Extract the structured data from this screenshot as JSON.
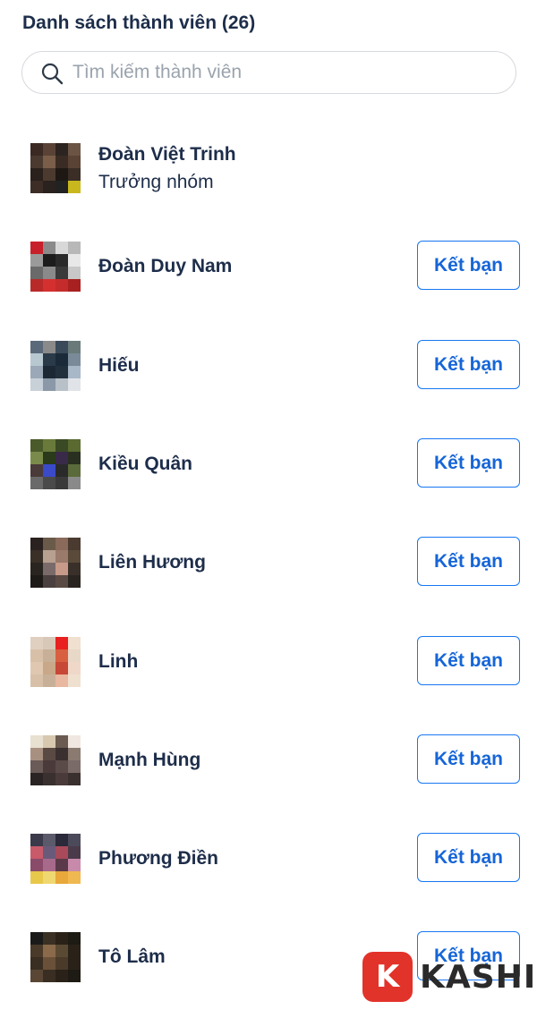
{
  "header": {
    "title": "Danh sách thành viên (26)"
  },
  "search": {
    "placeholder": "Tìm kiếm thành viên",
    "value": ""
  },
  "members": [
    {
      "name": "Đoàn Việt Trinh",
      "role": "Trưởng nhóm",
      "avatar": [
        "#3b2a24",
        "#5a4336",
        "#2c2420",
        "#6b5444",
        "#4a3a30",
        "#7a5e4a",
        "#3a2c24",
        "#5a4234",
        "#2a201c",
        "#4c3a2e",
        "#1e1814",
        "#3a2e26",
        "#3c2e26",
        "#2a221e",
        "#222",
        "#c8b81e"
      ]
    },
    {
      "name": "Đoàn Duy Nam",
      "button": "Kết bạn",
      "avatar": [
        "#c8202a",
        "#8a8a8a",
        "#d8d8d8",
        "#b8b8b8",
        "#9a9a9a",
        "#1c1c1c",
        "#2a2a2a",
        "#e8e8e8",
        "#6a6a6a",
        "#8a8a8a",
        "#3a3a3a",
        "#c8c8c8",
        "#b82a2a",
        "#d43030",
        "#c42c2c",
        "#a82020"
      ]
    },
    {
      "name": "Hiếu",
      "button": "Kết bạn",
      "avatar": [
        "#5a6a7a",
        "#8a8a8a",
        "#3a4a5a",
        "#6a7a7a",
        "#b8c8d0",
        "#2a3a48",
        "#1a2a38",
        "#7a8a98",
        "#9aa8b8",
        "#1c2834",
        "#22303e",
        "#a8b8c8",
        "#c8d0d8",
        "#8a98a8",
        "#b8c0c8",
        "#e0e4e8"
      ]
    },
    {
      "name": "Kiều Quân",
      "button": "Kết bạn",
      "avatar": [
        "#4a5a2a",
        "#6a7a3a",
        "#3a4a24",
        "#5a6a30",
        "#7a8a4a",
        "#2a3a1a",
        "#3a2a4a",
        "#2a3020",
        "#4a3a3a",
        "#3a4ac8",
        "#2a2a2a",
        "#5a6a3a",
        "#6a6a6a",
        "#4a4a4a",
        "#3a3a3a",
        "#8a8a8a"
      ]
    },
    {
      "name": "Liên Hương",
      "button": "Kết bạn",
      "avatar": [
        "#2a2220",
        "#6a5a4a",
        "#8a6a5a",
        "#4a3a30",
        "#3a3028",
        "#b8a090",
        "#9a7a6a",
        "#5a4a3a",
        "#2a2420",
        "#7a6a6a",
        "#c89a8a",
        "#3a302a",
        "#1e1a18",
        "#4a4040",
        "#5a4a44",
        "#2a2420"
      ]
    },
    {
      "name": "Linh",
      "button": "Kết bạn",
      "avatar": [
        "#e0d0c0",
        "#d8c8b8",
        "#e82020",
        "#f0e0d0",
        "#d8c0a8",
        "#c8b098",
        "#d86040",
        "#e8d8c8",
        "#e0c8b0",
        "#c8a888",
        "#c84838",
        "#f0d8c8",
        "#d8c0a8",
        "#c8b098",
        "#e8b8a0",
        "#f0e0d0"
      ]
    },
    {
      "name": "Mạnh Hùng",
      "button": "Kết bạn",
      "avatar": [
        "#e8e0d0",
        "#d8c8b0",
        "#6a5a50",
        "#f0e8e0",
        "#a89080",
        "#5a4a44",
        "#3a3030",
        "#8a7a70",
        "#6a5a58",
        "#4a3a3a",
        "#5a4a48",
        "#7a6a68",
        "#2a2424",
        "#3a3030",
        "#4a3a3a",
        "#3a3030"
      ]
    },
    {
      "name": "Phương Điền",
      "button": "Kết bạn",
      "avatar": [
        "#3a3a4a",
        "#5a5a6a",
        "#2a2a3a",
        "#4a4a5a",
        "#c85a6a",
        "#6a5a7a",
        "#a84a5a",
        "#4a3a4a",
        "#8a4a6a",
        "#a86a8a",
        "#5a3a4a",
        "#c88aaa",
        "#e8c84a",
        "#f0d870",
        "#e8a83a",
        "#f0b850"
      ]
    },
    {
      "name": "Tô Lâm",
      "button": "Kết bạn",
      "avatar": [
        "#1a1a1a",
        "#3a3024",
        "#2a2218",
        "#1e1a14",
        "#4a3a2a",
        "#8a6a4a",
        "#5a4a34",
        "#2a2218",
        "#3a2e22",
        "#6a5038",
        "#4a3a2a",
        "#2a2218",
        "#5a4634",
        "#3a2e22",
        "#2a2218",
        "#1e1a14"
      ]
    }
  ],
  "watermark": {
    "letter": "K",
    "text": "KASHI",
    "badge_color": "#e2332a"
  }
}
